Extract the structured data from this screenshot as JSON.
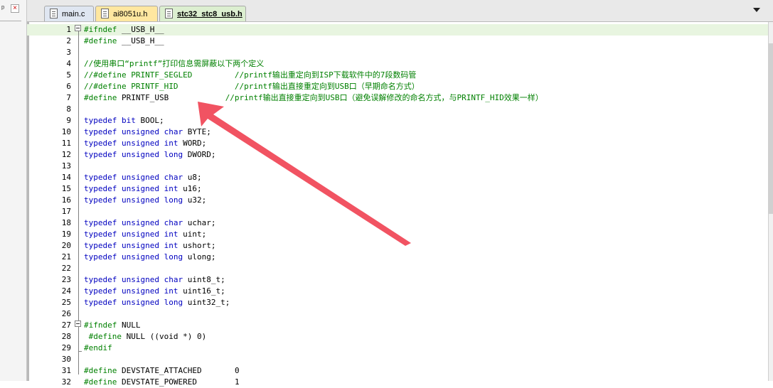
{
  "sidebar": {
    "pin_glyph": "ᵖ",
    "close_glyph": "×"
  },
  "tabs": [
    {
      "label": "main.c",
      "icon": "file-icon"
    },
    {
      "label": "ai8051u.h",
      "icon": "file-icon"
    },
    {
      "label": "stc32_stc8_usb.h",
      "icon": "file-icon",
      "active": true
    }
  ],
  "editor": {
    "lines": [
      {
        "n": "1",
        "tokens": [
          [
            "p",
            "#ifndef"
          ],
          [
            "t",
            " __USB_H__"
          ]
        ]
      },
      {
        "n": "2",
        "tokens": [
          [
            "p",
            "#define"
          ],
          [
            "t",
            " __USB_H__"
          ]
        ]
      },
      {
        "n": "3",
        "tokens": []
      },
      {
        "n": "4",
        "tokens": [
          [
            "c",
            "//使用串口“printf”打印信息需屏蔽以下两个定义"
          ]
        ]
      },
      {
        "n": "5",
        "tokens": [
          [
            "c",
            "//#define PRINTF_SEGLED         //printf输出重定向到ISP下载软件中的7段数码管"
          ]
        ]
      },
      {
        "n": "6",
        "tokens": [
          [
            "c",
            "//#define PRINTF_HID            //printf输出直接重定向到USB口（早期命名方式）"
          ]
        ]
      },
      {
        "n": "7",
        "tokens": [
          [
            "p",
            "#define"
          ],
          [
            "t",
            " PRINTF_USB            "
          ],
          [
            "c",
            "//printf输出直接重定向到USB口（避免误解修改的命名方式，与PRINTF_HID效果一样）"
          ]
        ]
      },
      {
        "n": "8",
        "tokens": []
      },
      {
        "n": "9",
        "tokens": [
          [
            "k",
            "typedef"
          ],
          [
            "t",
            " "
          ],
          [
            "k",
            "bit"
          ],
          [
            "t",
            " BOOL;"
          ]
        ]
      },
      {
        "n": "10",
        "tokens": [
          [
            "k",
            "typedef"
          ],
          [
            "t",
            " "
          ],
          [
            "k",
            "unsigned"
          ],
          [
            "t",
            " "
          ],
          [
            "k",
            "char"
          ],
          [
            "t",
            " BYTE;"
          ]
        ]
      },
      {
        "n": "11",
        "tokens": [
          [
            "k",
            "typedef"
          ],
          [
            "t",
            " "
          ],
          [
            "k",
            "unsigned"
          ],
          [
            "t",
            " "
          ],
          [
            "k",
            "int"
          ],
          [
            "t",
            " WORD;"
          ]
        ]
      },
      {
        "n": "12",
        "tokens": [
          [
            "k",
            "typedef"
          ],
          [
            "t",
            " "
          ],
          [
            "k",
            "unsigned"
          ],
          [
            "t",
            " "
          ],
          [
            "k",
            "long"
          ],
          [
            "t",
            " DWORD;"
          ]
        ]
      },
      {
        "n": "13",
        "tokens": []
      },
      {
        "n": "14",
        "tokens": [
          [
            "k",
            "typedef"
          ],
          [
            "t",
            " "
          ],
          [
            "k",
            "unsigned"
          ],
          [
            "t",
            " "
          ],
          [
            "k",
            "char"
          ],
          [
            "t",
            " u8;"
          ]
        ]
      },
      {
        "n": "15",
        "tokens": [
          [
            "k",
            "typedef"
          ],
          [
            "t",
            " "
          ],
          [
            "k",
            "unsigned"
          ],
          [
            "t",
            " "
          ],
          [
            "k",
            "int"
          ],
          [
            "t",
            " u16;"
          ]
        ]
      },
      {
        "n": "16",
        "tokens": [
          [
            "k",
            "typedef"
          ],
          [
            "t",
            " "
          ],
          [
            "k",
            "unsigned"
          ],
          [
            "t",
            " "
          ],
          [
            "k",
            "long"
          ],
          [
            "t",
            " u32;"
          ]
        ]
      },
      {
        "n": "17",
        "tokens": []
      },
      {
        "n": "18",
        "tokens": [
          [
            "k",
            "typedef"
          ],
          [
            "t",
            " "
          ],
          [
            "k",
            "unsigned"
          ],
          [
            "t",
            " "
          ],
          [
            "k",
            "char"
          ],
          [
            "t",
            " uchar;"
          ]
        ]
      },
      {
        "n": "19",
        "tokens": [
          [
            "k",
            "typedef"
          ],
          [
            "t",
            " "
          ],
          [
            "k",
            "unsigned"
          ],
          [
            "t",
            " "
          ],
          [
            "k",
            "int"
          ],
          [
            "t",
            " uint;"
          ]
        ]
      },
      {
        "n": "20",
        "tokens": [
          [
            "k",
            "typedef"
          ],
          [
            "t",
            " "
          ],
          [
            "k",
            "unsigned"
          ],
          [
            "t",
            " "
          ],
          [
            "k",
            "int"
          ],
          [
            "t",
            " ushort;"
          ]
        ]
      },
      {
        "n": "21",
        "tokens": [
          [
            "k",
            "typedef"
          ],
          [
            "t",
            " "
          ],
          [
            "k",
            "unsigned"
          ],
          [
            "t",
            " "
          ],
          [
            "k",
            "long"
          ],
          [
            "t",
            " ulong;"
          ]
        ]
      },
      {
        "n": "22",
        "tokens": []
      },
      {
        "n": "23",
        "tokens": [
          [
            "k",
            "typedef"
          ],
          [
            "t",
            " "
          ],
          [
            "k",
            "unsigned"
          ],
          [
            "t",
            " "
          ],
          [
            "k",
            "char"
          ],
          [
            "t",
            " uint8_t;"
          ]
        ]
      },
      {
        "n": "24",
        "tokens": [
          [
            "k",
            "typedef"
          ],
          [
            "t",
            " "
          ],
          [
            "k",
            "unsigned"
          ],
          [
            "t",
            " "
          ],
          [
            "k",
            "int"
          ],
          [
            "t",
            " uint16_t;"
          ]
        ]
      },
      {
        "n": "25",
        "tokens": [
          [
            "k",
            "typedef"
          ],
          [
            "t",
            " "
          ],
          [
            "k",
            "unsigned"
          ],
          [
            "t",
            " "
          ],
          [
            "k",
            "long"
          ],
          [
            "t",
            " uint32_t;"
          ]
        ]
      },
      {
        "n": "26",
        "tokens": []
      },
      {
        "n": "27",
        "tokens": [
          [
            "p",
            "#ifndef"
          ],
          [
            "t",
            " NULL"
          ]
        ]
      },
      {
        "n": "28",
        "tokens": [
          [
            "p",
            " #define"
          ],
          [
            "t",
            " NULL ((void *) 0)"
          ]
        ]
      },
      {
        "n": "29",
        "tokens": [
          [
            "p",
            "#endif"
          ]
        ]
      },
      {
        "n": "30",
        "tokens": []
      },
      {
        "n": "31",
        "tokens": [
          [
            "p",
            "#define"
          ],
          [
            "t",
            " DEVSTATE_ATTACHED       "
          ],
          [
            "t",
            "0"
          ]
        ]
      },
      {
        "n": "32",
        "tokens": [
          [
            "p",
            "#define"
          ],
          [
            "t",
            " DEVSTATE_POWERED        "
          ],
          [
            "t",
            "1"
          ]
        ]
      }
    ]
  },
  "colors": {
    "keyword": "#0000c0",
    "comment": "#008000",
    "preprocessor": "#008000",
    "annotation_arrow": "#f04a5a"
  }
}
